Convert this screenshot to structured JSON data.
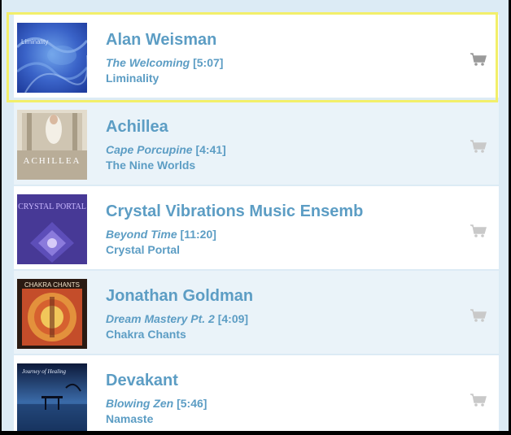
{
  "tracks": [
    {
      "artist": "Alan Weisman",
      "title": "The Welcoming",
      "duration": "[5:07]",
      "album": "Liminality",
      "cover_text": "Liminality",
      "selected": true,
      "cart_icon": "shopping-cart-icon"
    },
    {
      "artist": "Achillea",
      "title": "Cape Porcupine",
      "duration": "[4:41]",
      "album": "The Nine Worlds",
      "cover_text": "ACHILLEA",
      "selected": false,
      "cart_icon": "shopping-cart-icon"
    },
    {
      "artist": "Crystal Vibrations Music Ensemb",
      "title": "Beyond Time",
      "duration": "[11:20]",
      "album": "Crystal Portal",
      "cover_text": "CRYSTAL PORTAL",
      "selected": false,
      "cart_icon": "shopping-cart-icon"
    },
    {
      "artist": "Jonathan Goldman",
      "title": "Dream Mastery Pt. 2",
      "duration": "[4:09]",
      "album": "Chakra Chants",
      "cover_text": "CHAKRA CHANTS",
      "selected": false,
      "cart_icon": "shopping-cart-icon"
    },
    {
      "artist": "Devakant",
      "title": "Blowing Zen",
      "duration": "[5:46]",
      "album": "Namaste",
      "cover_text": "Journey of Healing",
      "selected": false,
      "cart_icon": "shopping-cart-icon"
    }
  ],
  "colors": {
    "background": "#dcebf5",
    "text_accent": "#5c9dc4",
    "selection_border": "#f2ef6a",
    "cart_active": "#9a9a9a",
    "cart_inactive": "#c9c9c9"
  }
}
